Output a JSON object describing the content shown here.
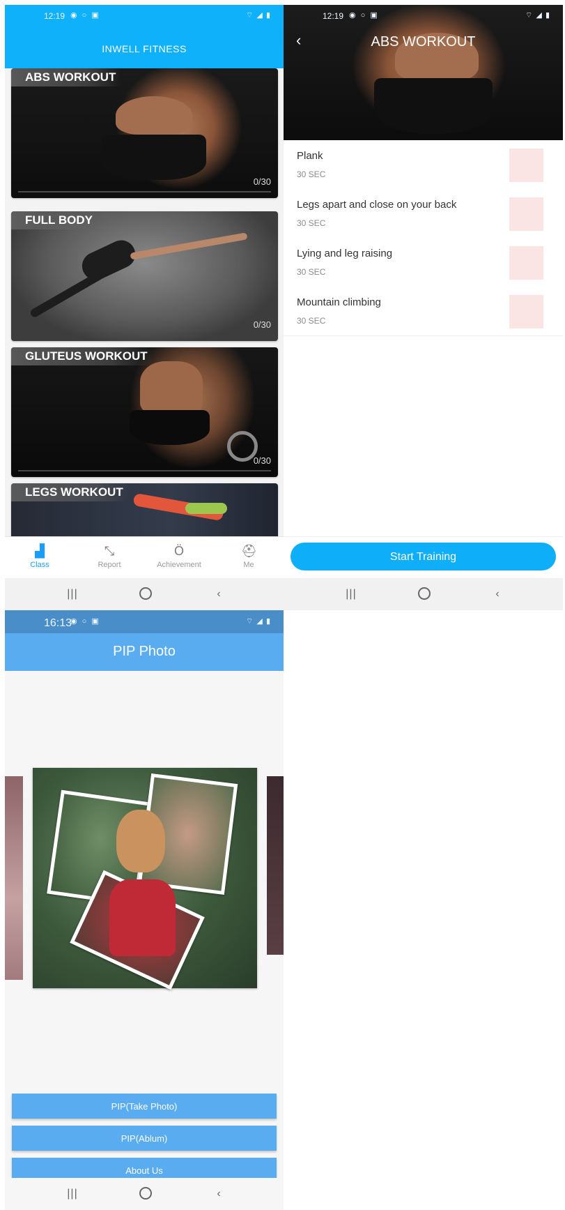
{
  "panel1": {
    "status": {
      "time": "12:19"
    },
    "app_title": "INWELL FITNESS",
    "cards": [
      {
        "label": "ABS WORKOUT",
        "count": "0/30"
      },
      {
        "label": "FULL BODY",
        "count": "0/30"
      },
      {
        "label": "GLUTEUS WORKOUT",
        "count": "0/30"
      },
      {
        "label": "LEGS WORKOUT",
        "count": ""
      }
    ],
    "tabs": [
      {
        "label": "Class",
        "icon": "bar-chart-icon",
        "active": true
      },
      {
        "label": "Report",
        "icon": "arrows-icon",
        "active": false
      },
      {
        "label": "Achievement",
        "icon": "medal-icon",
        "active": false
      },
      {
        "label": "Me",
        "icon": "person-icon",
        "active": false
      }
    ]
  },
  "panel2": {
    "status": {
      "time": "12:19"
    },
    "title": "ABS WORKOUT",
    "exercises": [
      {
        "name": "Plank",
        "duration": "30 SEC"
      },
      {
        "name": "Legs apart and close on your back",
        "duration": "30 SEC"
      },
      {
        "name": "Lying and leg raising",
        "duration": "30 SEC"
      },
      {
        "name": "Mountain climbing",
        "duration": "30 SEC"
      }
    ],
    "start_button": "Start Training"
  },
  "panel3": {
    "status": {
      "time": "16:13"
    },
    "title": "PIP Photo",
    "buttons": {
      "take_photo": "PIP(Take Photo)",
      "album": "PIP(Ablum)",
      "about": "About Us"
    }
  },
  "colors": {
    "fitness_accent": "#0fb1fb",
    "pip_accent": "#5aacf0"
  }
}
